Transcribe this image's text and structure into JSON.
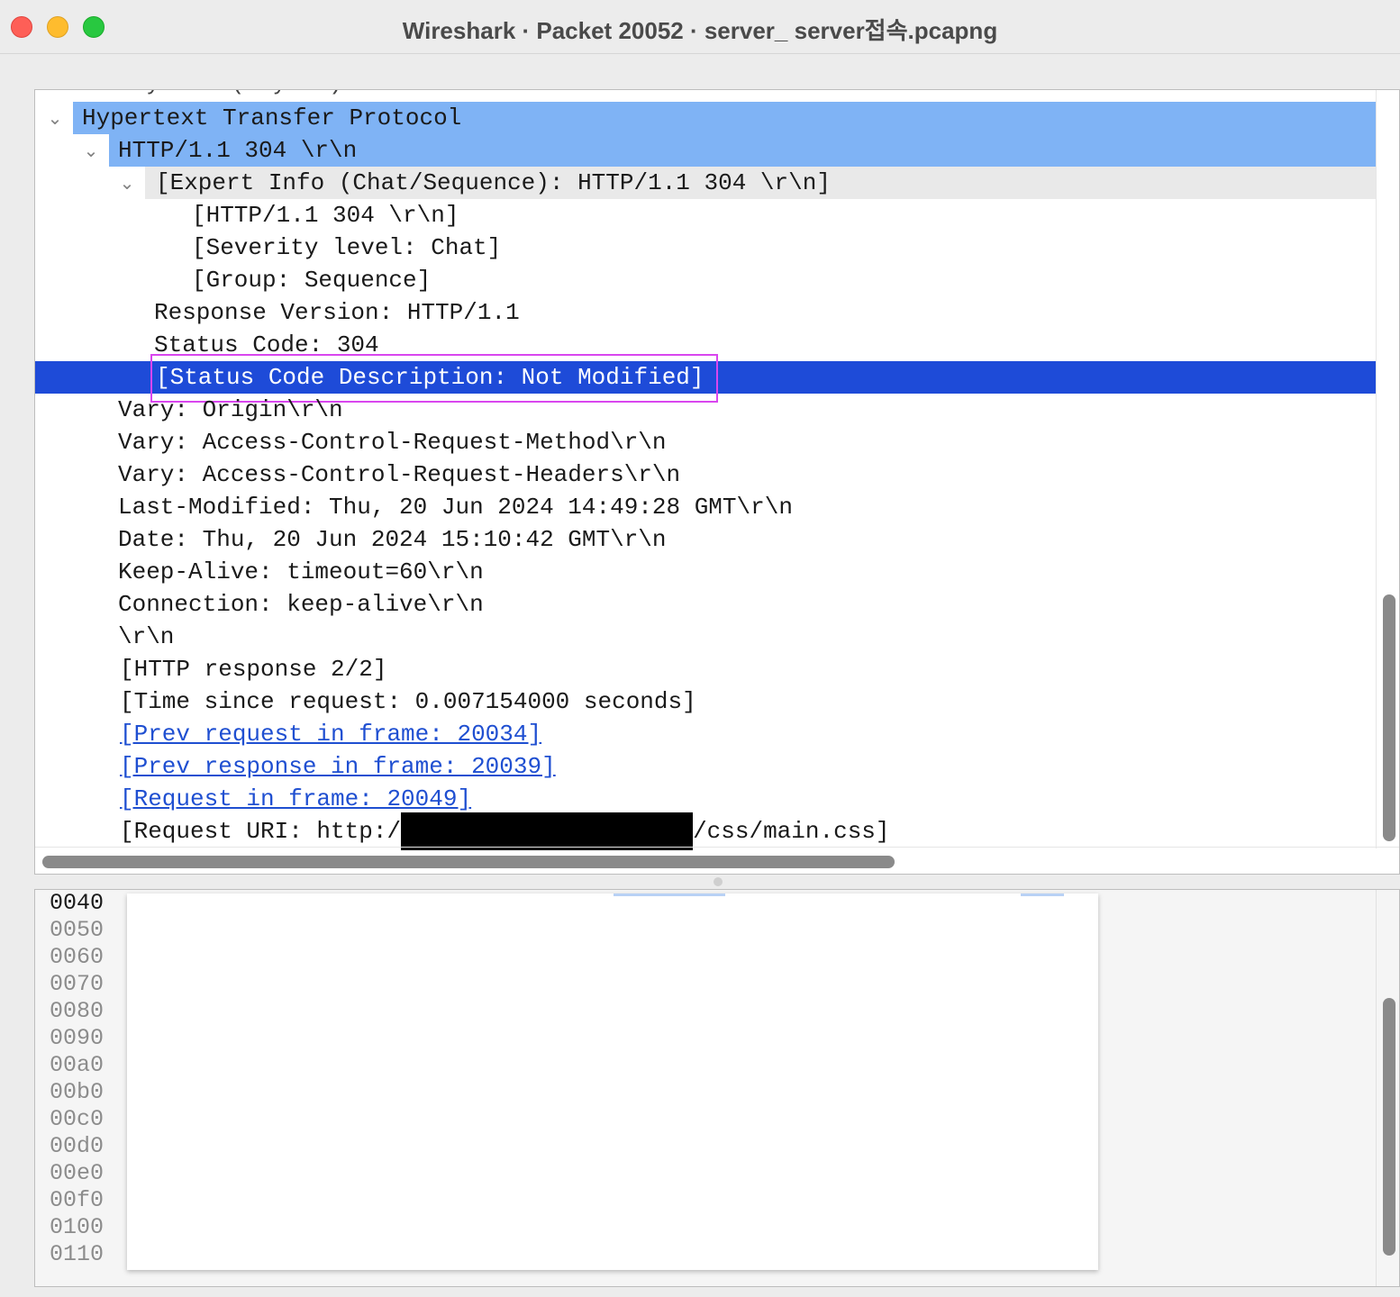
{
  "window": {
    "title": "Wireshark · Packet 20052 · server_ server접속.pcapng"
  },
  "tree": {
    "clipped_top": "Payload:(…bytes)",
    "http_header": "Hypertext Transfer Protocol",
    "status_line": "HTTP/1.1 304 \\r\\n",
    "expert_info": "[Expert Info (Chat/Sequence): HTTP/1.1 304 \\r\\n]",
    "expert_http": "[HTTP/1.1 304 \\r\\n]",
    "severity": "[Severity level: Chat]",
    "group": "[Group: Sequence]",
    "response_version": "Response Version: HTTP/1.1",
    "status_code": "Status Code: 304",
    "status_desc": "[Status Code Description: Not Modified]",
    "vary_origin": "Vary: Origin\\r\\n",
    "vary_method": "Vary: Access-Control-Request-Method\\r\\n",
    "vary_headers": "Vary: Access-Control-Request-Headers\\r\\n",
    "last_modified": "Last-Modified: Thu, 20 Jun 2024 14:49:28 GMT\\r\\n",
    "date": "Date: Thu, 20 Jun 2024 15:10:42 GMT\\r\\n",
    "keep_alive": "Keep-Alive: timeout=60\\r\\n",
    "connection": "Connection: keep-alive\\r\\n",
    "crlf": "\\r\\n",
    "http_response": "[HTTP response 2/2]",
    "time_since": "[Time since request: 0.007154000 seconds]",
    "prev_request": "[Prev request in frame: 20034]",
    "prev_response": "[Prev response in frame: 20039]",
    "request_in": "[Request in frame: 20049]",
    "request_uri_prefix": "[Request URI: http:/",
    "request_uri_suffix": "/css/main.css]"
  },
  "hex": {
    "offsets": [
      "0040",
      "0050",
      "0060",
      "0070",
      "0080",
      "0090",
      "00a0",
      "00b0",
      "00c0",
      "00d0",
      "00e0",
      "00f0",
      "0100",
      "0110"
    ]
  },
  "colors": {
    "tree_highlight": "#7fb3f5",
    "expert_row_bg": "#e9e9e9",
    "selected_row": "#1e4bd8",
    "annotation_box": "#d946ef",
    "link": "#1f4fd1"
  },
  "icons": {
    "expand": "chevron-down-icon"
  }
}
